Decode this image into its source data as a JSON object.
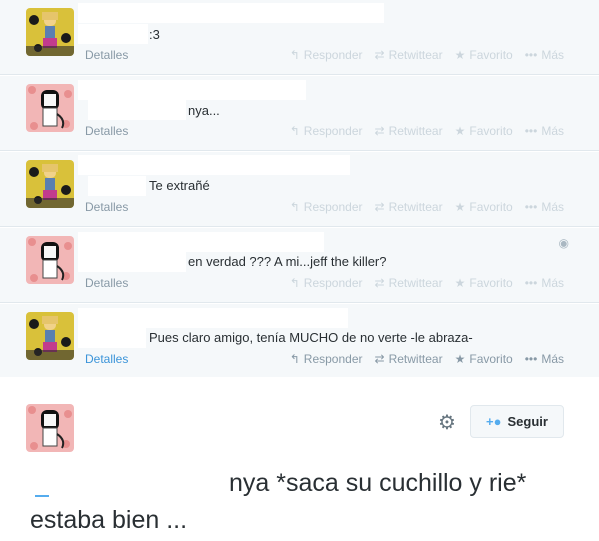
{
  "tweets": [
    {
      "text": ":3",
      "details": "Detalles"
    },
    {
      "text": "nya...",
      "details": "Detalles"
    },
    {
      "text": "Te extrañé",
      "details": "Detalles"
    },
    {
      "text": "en verdad ??? A mi...jeff the killer?",
      "details": "Detalles"
    },
    {
      "text": "Pues claro amigo, tenía MUCHO de no verte -le abraza-",
      "details": "Detalles"
    }
  ],
  "actions": {
    "reply": "Responder",
    "retweet": "Retwittear",
    "favorite": "Favorito",
    "more": "Más"
  },
  "main_tweet": {
    "follow_label": "Seguir",
    "line1": "nya *saca su cuchillo y rie*",
    "line2": "estaba bien ..."
  },
  "icons": {
    "reply": "reply-icon",
    "retweet": "retweet-icon",
    "favorite": "star-icon",
    "more": "more-dots-icon",
    "settings": "gear-icon",
    "follow": "add-user-icon",
    "globe": "globe-icon"
  },
  "colors": {
    "link_blue": "#3b94d9",
    "tweet_bg": "#f5f8fa",
    "muted": "#8899a6",
    "faint": "#ccd6dd"
  }
}
